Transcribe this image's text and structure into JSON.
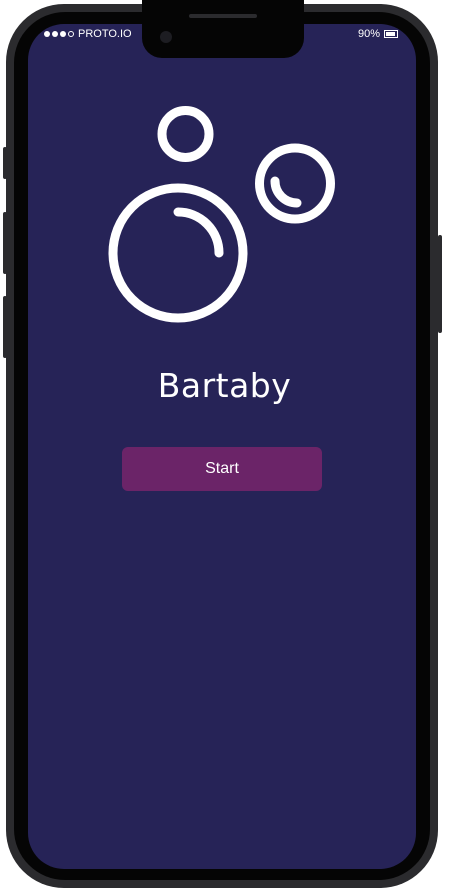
{
  "status_bar": {
    "carrier": "PROTO.IO",
    "battery": "90%",
    "battery_level": 0.9,
    "signal_dots_filled": 3,
    "signal_dots_total": 4
  },
  "app": {
    "title": "Bartaby",
    "start_label": "Start",
    "logo_icon": "bubbles-icon"
  },
  "colors": {
    "screen_background": "#262357",
    "button_background": "#6b2468",
    "text": "#ffffff",
    "device_frame": "#2b2b2e"
  }
}
